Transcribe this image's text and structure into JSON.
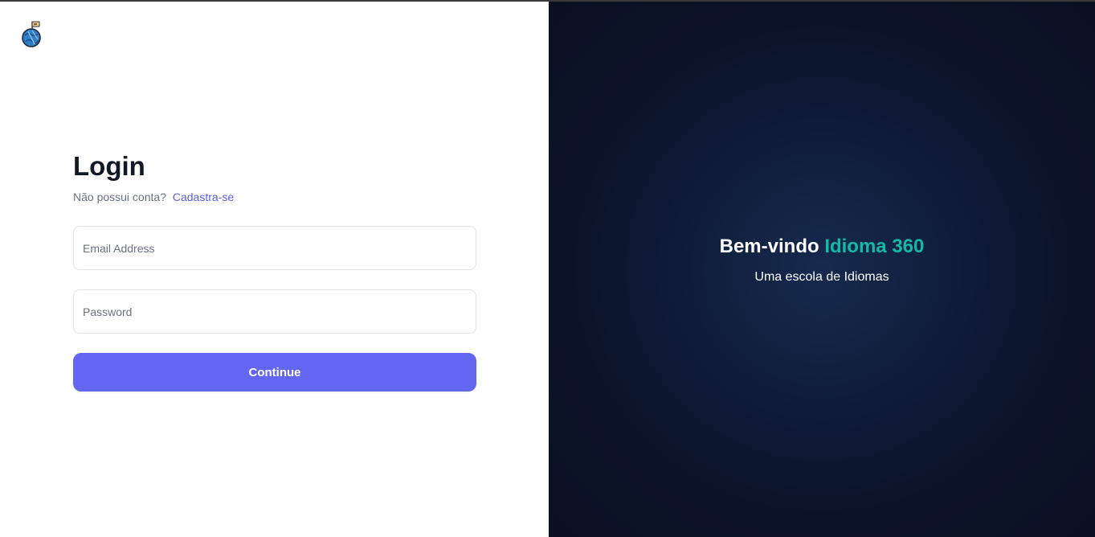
{
  "login": {
    "title": "Login",
    "no_account_text": "Não possui conta?",
    "signup_link": "Cadastra-se",
    "email_placeholder": "Email Address",
    "email_value": "",
    "password_placeholder": "Password",
    "password_value": "",
    "continue_label": "Continue"
  },
  "hero": {
    "welcome_prefix": "Bem-vindo",
    "brand_name": "Idioma 360",
    "tagline": "Uma escola de Idiomas"
  },
  "logo": {
    "icon": "globe-flag-icon"
  },
  "colors": {
    "accent": "#6366f1",
    "link": "#5b5fe0",
    "brand": "#14b8a6",
    "hero_bg": "#0b1328"
  }
}
